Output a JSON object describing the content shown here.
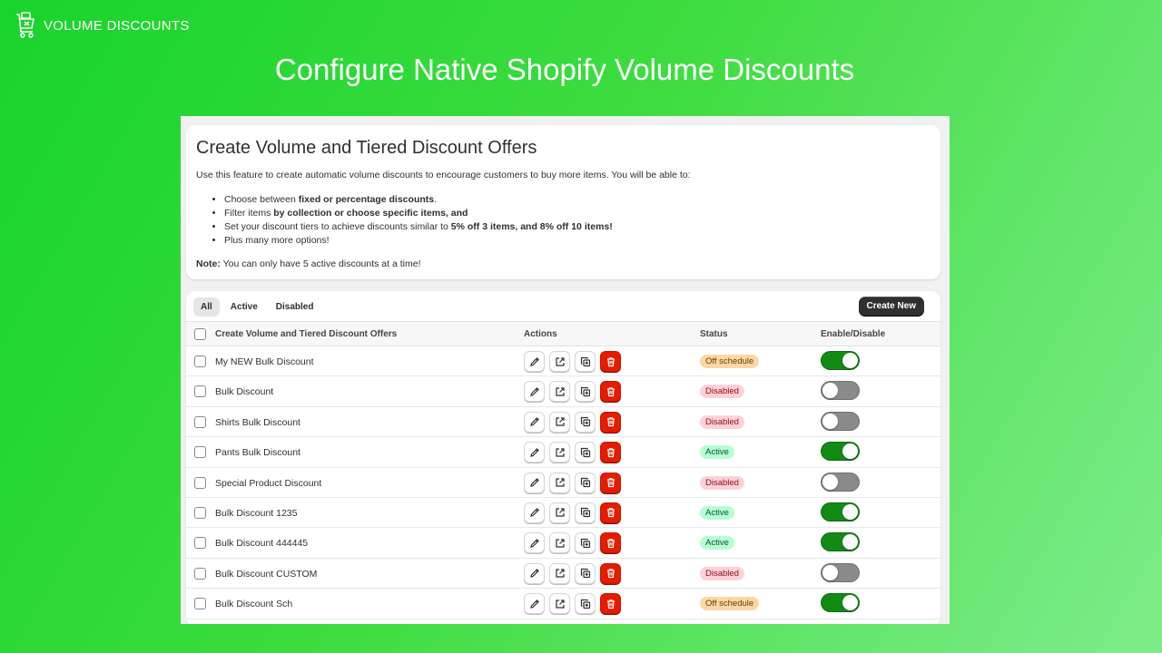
{
  "brand": {
    "name": "VOLUME DISCOUNTS",
    "logo_icon": "shopping-bag-cart-icon"
  },
  "hero": {
    "title": "Configure Native Shopify Volume Discounts"
  },
  "intro": {
    "title": "Create Volume and Tiered Discount Offers",
    "description": "Use this feature to create automatic volume discounts to encourage customers to buy more items. You will be able to:",
    "bullets": [
      {
        "prefix": "Choose between ",
        "bold": "fixed or percentage discounts",
        "suffix": "."
      },
      {
        "prefix": "Filter items ",
        "bold": "by collection or choose specific items, and",
        "suffix": ""
      },
      {
        "prefix": "Set your discount tiers to achieve discounts similar to ",
        "bold": "5% off 3 items, and 8% off 10 items!",
        "suffix": ""
      },
      {
        "prefix": "Plus many more options!",
        "bold": "",
        "suffix": ""
      }
    ],
    "note_label": "Note:",
    "note_text": " You can only have 5 active discounts at a time!"
  },
  "tabs": [
    "All",
    "Active",
    "Disabled"
  ],
  "selected_tab": "All",
  "create_button": "Create New",
  "columns": {
    "name": "Create Volume and Tiered Discount Offers",
    "actions": "Actions",
    "status": "Status",
    "toggle": "Enable/Disable"
  },
  "action_icons": [
    "edit-pencil-icon",
    "external-link-icon",
    "duplicate-icon",
    "delete-trash-icon"
  ],
  "colors": {
    "toggle_on": "#128a14",
    "toggle_off": "#8a8a8a",
    "delete": "#e51c00",
    "badge_off_schedule": "#ffd6a4",
    "badge_disabled": "#fed1d7",
    "badge_active": "#b4fed2"
  },
  "rows": [
    {
      "name": "My NEW Bulk Discount",
      "status": "Off schedule",
      "status_type": "off",
      "enabled": true
    },
    {
      "name": "Bulk Discount",
      "status": "Disabled",
      "status_type": "disabled",
      "enabled": false
    },
    {
      "name": "Shirts Bulk Discount",
      "status": "Disabled",
      "status_type": "disabled",
      "enabled": false
    },
    {
      "name": "Pants Bulk Discount",
      "status": "Active",
      "status_type": "active",
      "enabled": true
    },
    {
      "name": "Special Product Discount",
      "status": "Disabled",
      "status_type": "disabled",
      "enabled": false
    },
    {
      "name": "Bulk Discount 1235",
      "status": "Active",
      "status_type": "active",
      "enabled": true
    },
    {
      "name": "Bulk Discount 444445",
      "status": "Active",
      "status_type": "active",
      "enabled": true
    },
    {
      "name": "Bulk Discount CUSTOM",
      "status": "Disabled",
      "status_type": "disabled",
      "enabled": false
    },
    {
      "name": "Bulk Discount Sch",
      "status": "Off schedule",
      "status_type": "off",
      "enabled": true
    }
  ]
}
